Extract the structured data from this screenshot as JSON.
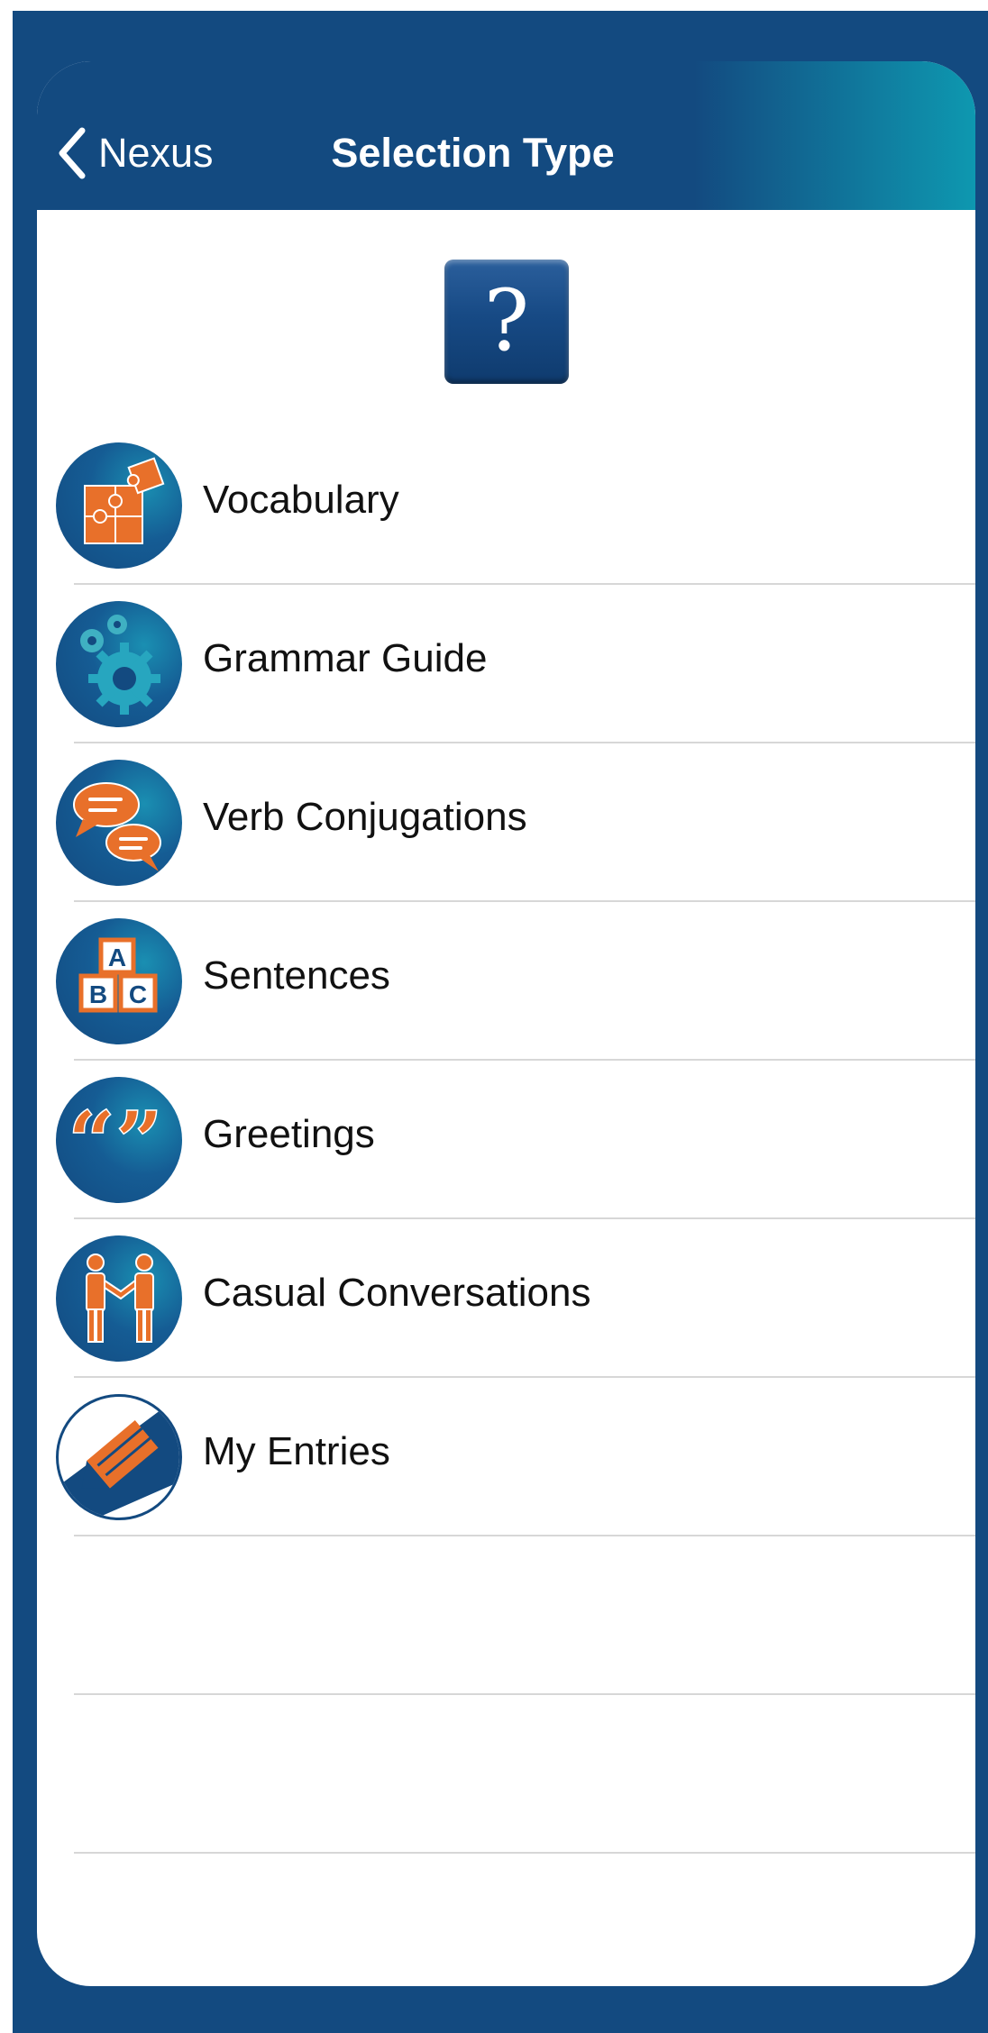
{
  "nav": {
    "back_label": "Nexus",
    "title": "Selection Type"
  },
  "help_button": {
    "glyph": "?"
  },
  "items": [
    {
      "label": "Vocabulary",
      "icon": "puzzle-icon"
    },
    {
      "label": "Grammar Guide",
      "icon": "gears-icon"
    },
    {
      "label": "Verb Conjugations",
      "icon": "speech-bubbles-icon"
    },
    {
      "label": "Sentences",
      "icon": "abc-blocks-icon"
    },
    {
      "label": "Greetings",
      "icon": "quotation-marks-icon"
    },
    {
      "label": "Casual Conversations",
      "icon": "handshake-people-icon"
    },
    {
      "label": "My Entries",
      "icon": "pencil-check-icon"
    }
  ],
  "colors": {
    "navy": "#134a80",
    "teal": "#0e98b0",
    "orange": "#e8702a",
    "separator": "#d7d7d7"
  }
}
